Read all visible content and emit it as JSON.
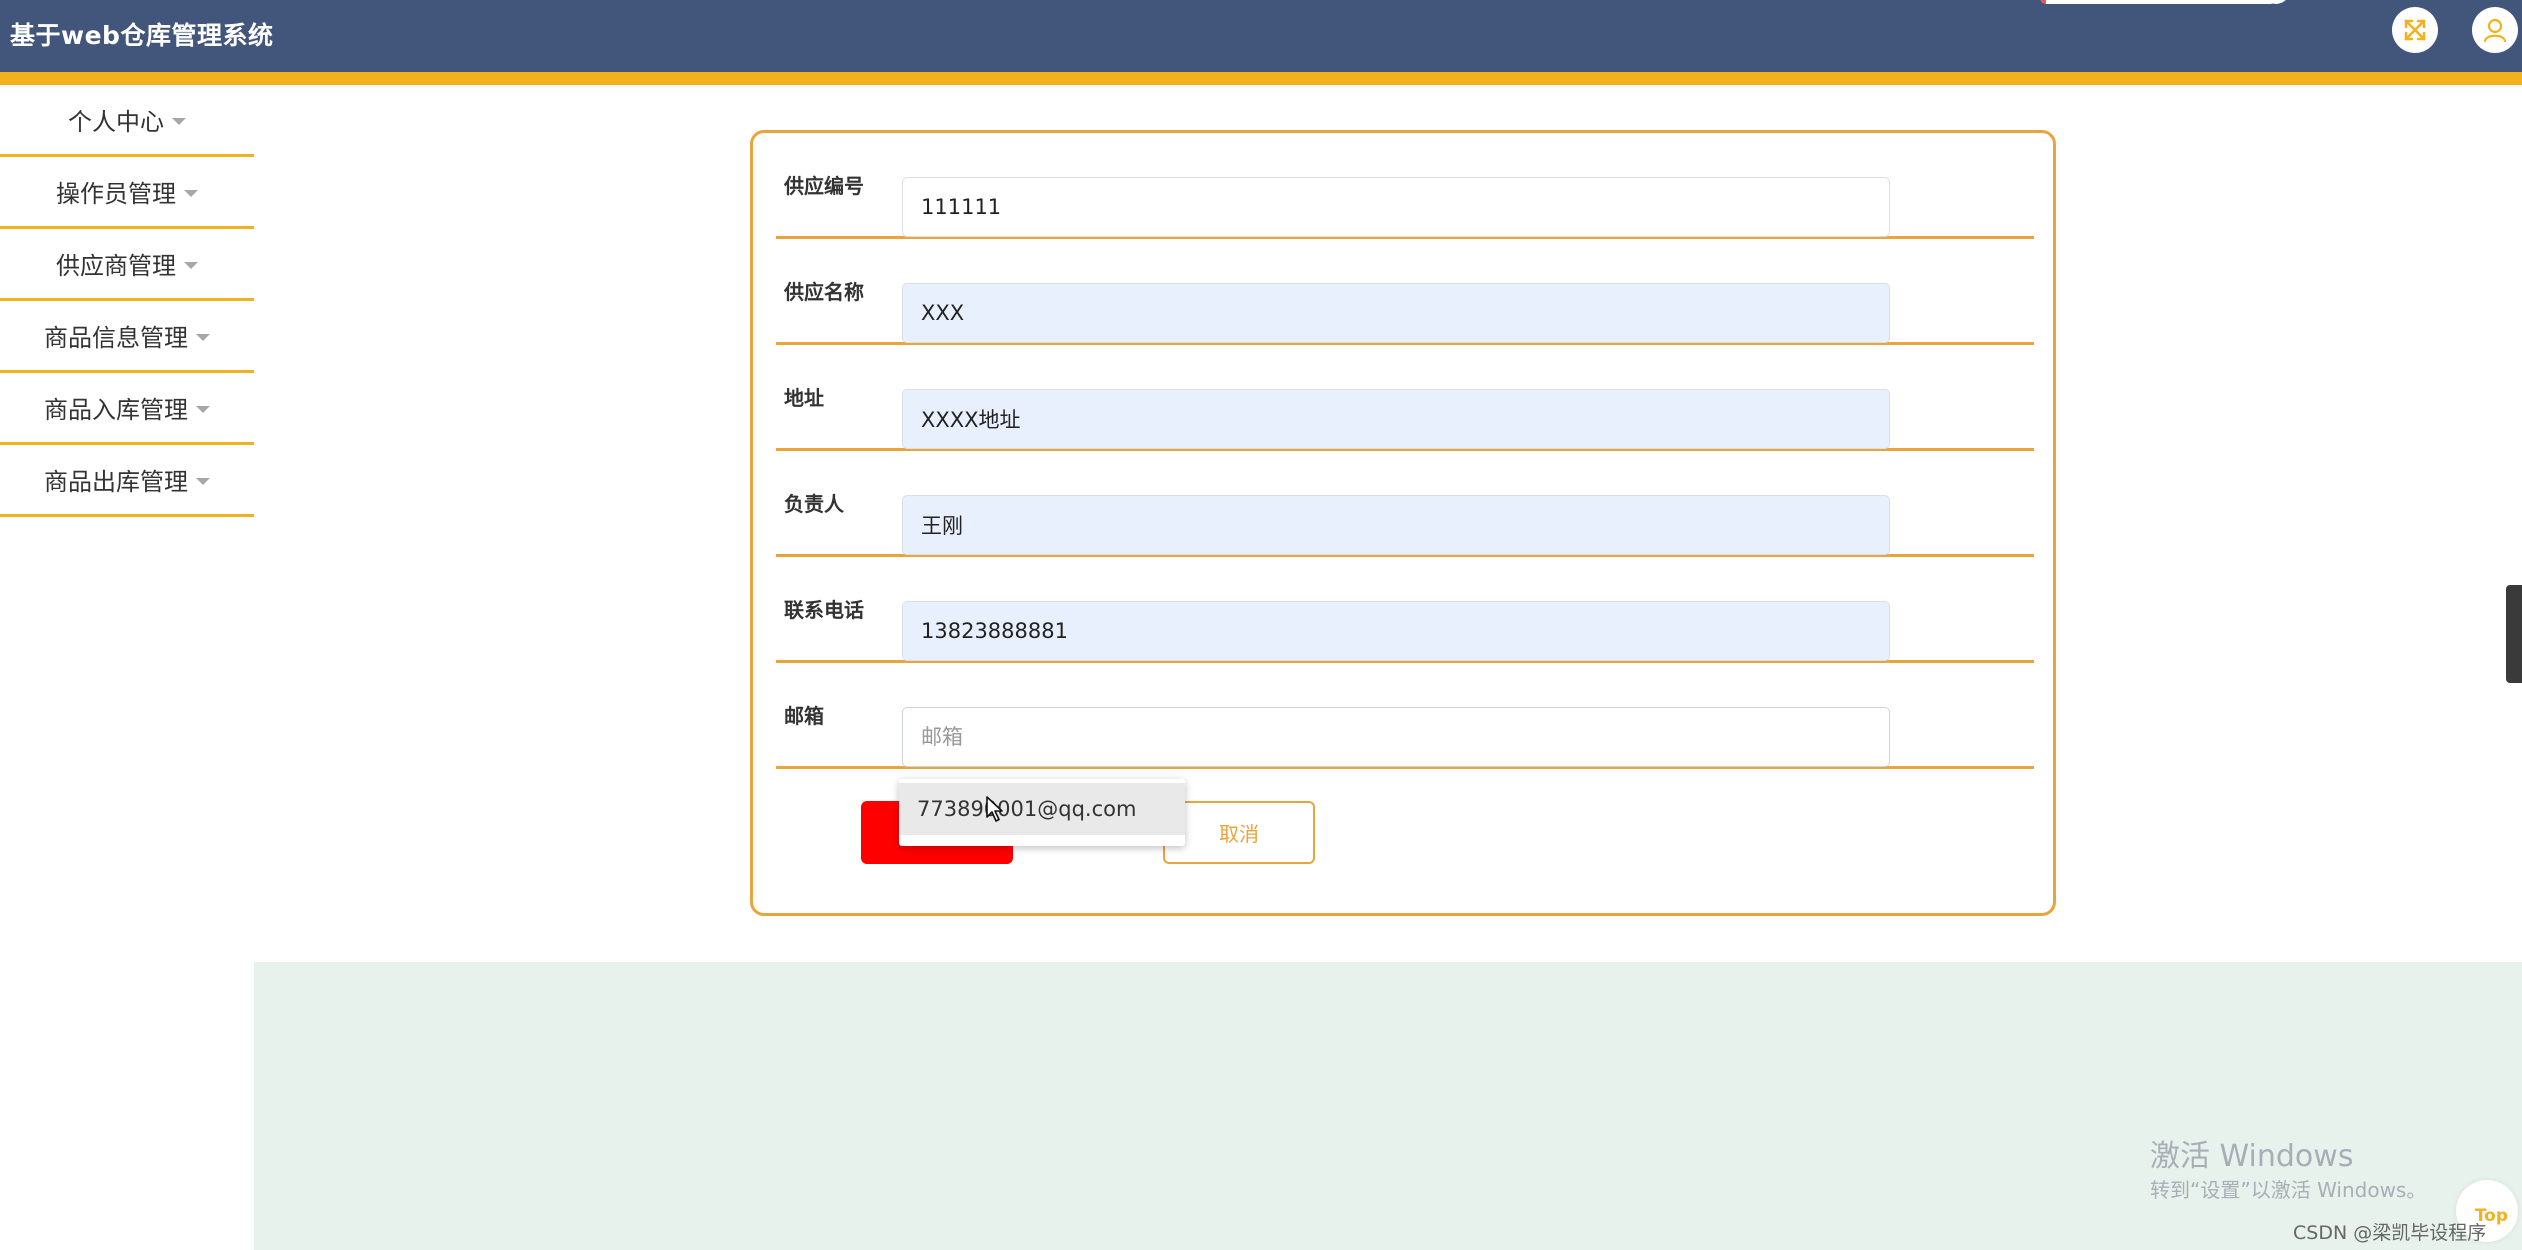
{
  "header": {
    "title": "基于web仓库管理系统",
    "fullscreen_icon": "fullscreen-icon",
    "user_icon": "user-icon"
  },
  "sidebar": {
    "items": [
      {
        "label": "个人中心"
      },
      {
        "label": "操作员管理"
      },
      {
        "label": "供应商管理"
      },
      {
        "label": "商品信息管理"
      },
      {
        "label": "商品入库管理"
      },
      {
        "label": "商品出库管理"
      }
    ]
  },
  "form": {
    "fields": [
      {
        "label": "供应编号",
        "value": "111111",
        "placeholder": ""
      },
      {
        "label": "供应名称",
        "value": "XXX",
        "placeholder": ""
      },
      {
        "label": "地址",
        "value": "XXXX地址",
        "placeholder": ""
      },
      {
        "label": "负责人",
        "value": "王刚",
        "placeholder": ""
      },
      {
        "label": "联系电话",
        "value": "13823888881",
        "placeholder": ""
      },
      {
        "label": "邮箱",
        "value": "",
        "placeholder": "邮箱"
      }
    ],
    "cancel_label": "取消",
    "autocomplete_suggestion": "773890001@qq.com"
  },
  "colors": {
    "header_bg": "#42557a",
    "accent": "#f3b11d",
    "form_border": "#eaa43c",
    "submit_bg": "#ff0000",
    "bottom_band": "#e8f2ec"
  },
  "watermark": {
    "title": "激活 Windows",
    "subtitle": "转到“设置”以激活 Windows。"
  },
  "back_to_top_label": "Top",
  "csdn_mark": "CSDN @梁凯毕设程序"
}
